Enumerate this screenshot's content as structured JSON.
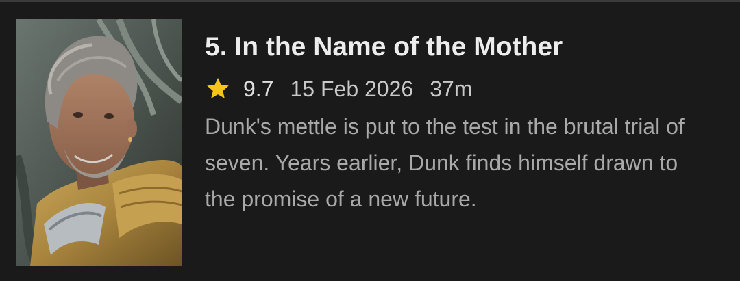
{
  "episode": {
    "title": "5. In the Name of the Mother",
    "rating": "9.7",
    "air_date": "15 Feb 2026",
    "runtime": "37m",
    "overview": "Dunk's mettle is put to the test in the brutal trial of seven. Years earlier, Dunk finds himself drawn to the promise of a new future."
  },
  "colors": {
    "background": "#1a1a1a",
    "title": "#ededed",
    "meta": "#c9c9c9",
    "overview": "#a9a9a9",
    "star": "#f5c518"
  },
  "icons": {
    "rating": "star-icon"
  }
}
